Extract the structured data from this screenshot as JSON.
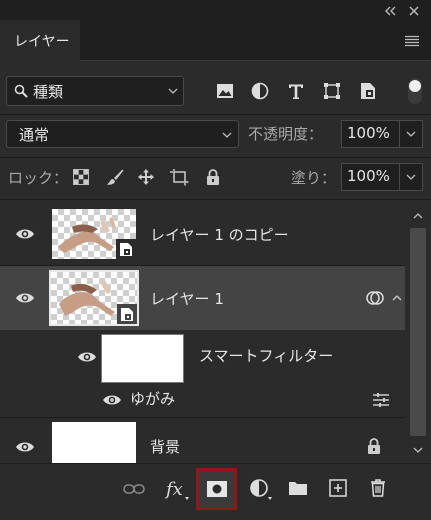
{
  "panel": {
    "tab_label": "レイヤー"
  },
  "filter_row": {
    "kind_label": "種類"
  },
  "blend_row": {
    "blend_mode": "通常",
    "opacity_label": "不透明度：",
    "opacity_value": "100%"
  },
  "lock_row": {
    "lock_label": "ロック：",
    "fill_label": "塗り：",
    "fill_value": "100%"
  },
  "layers": {
    "copy": {
      "name": "レイヤー 1 のコピー"
    },
    "layer1": {
      "name": "レイヤー 1"
    },
    "smart_filter": {
      "name": "スマートフィルター"
    },
    "warp": {
      "name": "ゆがみ"
    },
    "background": {
      "name": "背景"
    }
  },
  "colors": {
    "panel_bg": "#2b2b2b",
    "selected_row": "#444444",
    "highlight_border": "#8b1a1a"
  }
}
